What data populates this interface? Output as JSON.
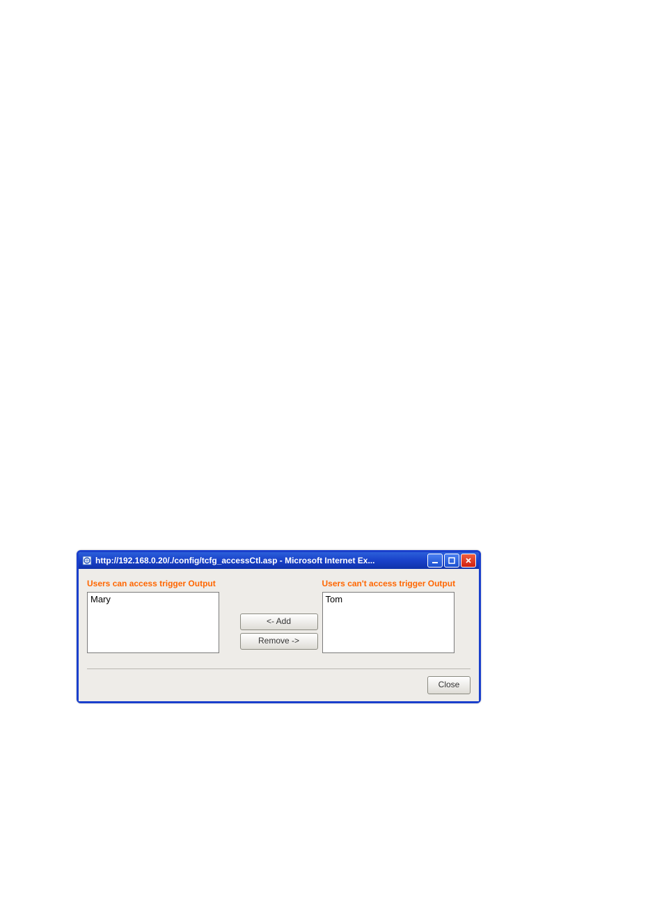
{
  "window": {
    "title": "http://192.168.0.20/./config/tcfg_accessCtl.asp - Microsoft Internet Ex..."
  },
  "panel": {
    "leftHeading": "Users can access trigger Output",
    "rightHeading": "Users can't access trigger Output",
    "leftUsers": [
      "Mary"
    ],
    "rightUsers": [
      "Tom"
    ],
    "addLabel": "<-   Add",
    "removeLabel": "Remove ->",
    "closeLabel": "Close"
  }
}
